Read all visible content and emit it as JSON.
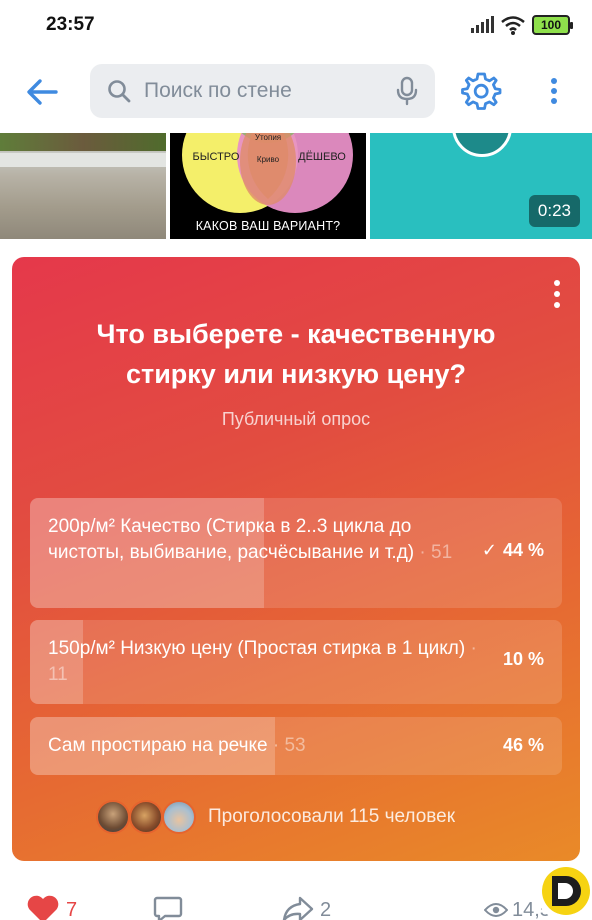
{
  "status_bar": {
    "time": "23:57",
    "battery": "100"
  },
  "toolbar": {
    "search_placeholder": "Поиск по стене"
  },
  "media": {
    "venn": {
      "left": "БЫСТРО",
      "right": "ДЁШЕВО",
      "top": "Утопия",
      "center": "Криво",
      "caption": "КАКОВ ВАШ ВАРИАНТ?"
    },
    "video_duration": "0:23"
  },
  "poll": {
    "question": "Что выберете - качественную стирку или низкую цену?",
    "kind": "Публичный опрос",
    "options": [
      {
        "text": "200р/м² Качество (Стирка в 2..3 цикла до чистоты, выбивание, расчёсывание и т.д)",
        "count": "· 51",
        "percent": "44 %",
        "fraction": 0.44,
        "voted": true
      },
      {
        "text": "150р/м² Низкую цену (Простая стирка в 1 цикл)",
        "count": "· 11",
        "percent": "10 %",
        "fraction": 0.1,
        "voted": false
      },
      {
        "text": "Сам простираю на речке",
        "count": "· 53",
        "percent": "46 %",
        "fraction": 0.46,
        "voted": false
      }
    ],
    "voters_text": "Проголосовали 115 человек"
  },
  "actions": {
    "likes": "7",
    "shares": "2",
    "views": "14,5K"
  },
  "colors": {
    "accent": "#3f8ae0",
    "like": "#e64646",
    "poll_start": "#e5384b",
    "poll_end": "#e98a28"
  }
}
